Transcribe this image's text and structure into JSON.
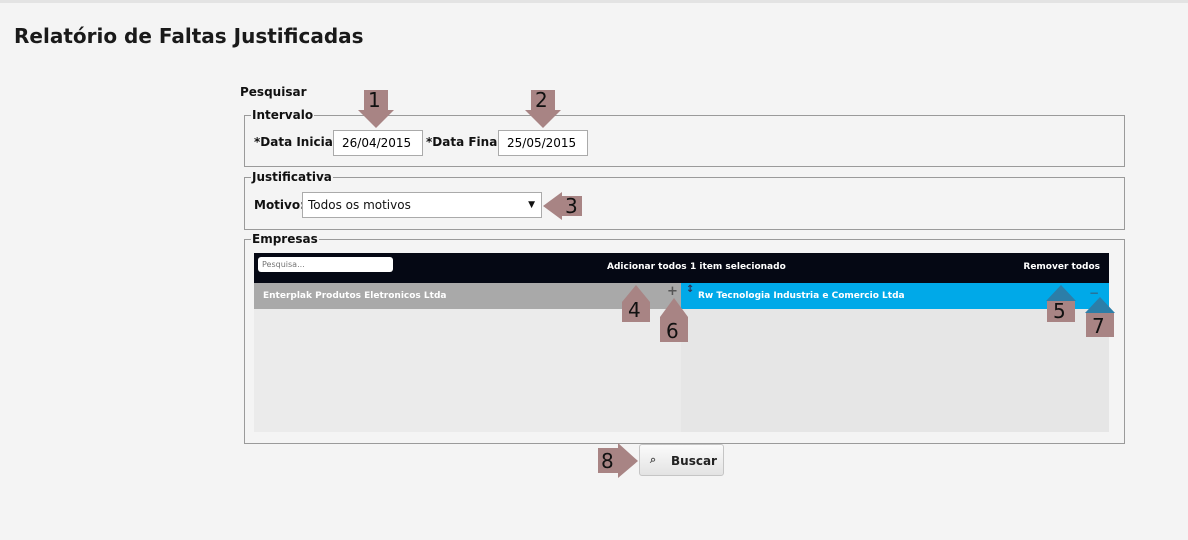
{
  "page_title": "Relatório de Faltas Justificadas",
  "search_label": "Pesquisar",
  "interval": {
    "legend": "Intervalo",
    "start_label": "*Data Inicial:",
    "start_value": "26/04/2015",
    "end_label": "*Data Final:",
    "end_value": "25/05/2015"
  },
  "justification": {
    "legend": "Justificativa",
    "reason_label": "Motivo:",
    "reason_selected": "Todos os motivos"
  },
  "companies": {
    "legend": "Empresas",
    "search_placeholder": "Pesquisa...",
    "add_all_label": "Adicionar todos",
    "selected_count": "1 item selecionado",
    "remove_all_label": "Remover todos",
    "available": [
      "Enterplak Produtos Eletronicos Ltda"
    ],
    "selected": [
      "Rw Tecnologia Industria e Comercio Ltda"
    ]
  },
  "search_button_label": "Buscar",
  "annotations": {
    "color": "#a88484",
    "numbers": [
      "1",
      "2",
      "3",
      "4",
      "5",
      "6",
      "7",
      "8"
    ]
  }
}
